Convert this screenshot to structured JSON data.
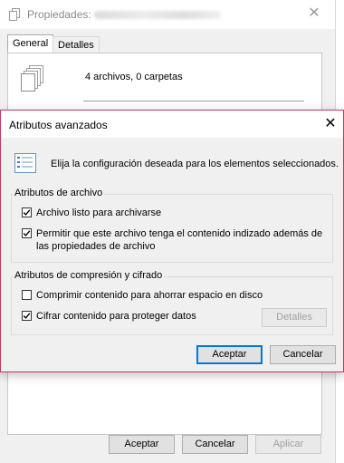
{
  "back_window": {
    "title": "Propiedades:",
    "tabs": [
      "General",
      "Detalles"
    ],
    "summary": "4 archivos, 0 carpetas",
    "buttons": {
      "accept": "Aceptar",
      "cancel": "Cancelar",
      "apply": "Aplicar"
    }
  },
  "dialog": {
    "title": "Atributos avanzados",
    "instruction": "Elija la configuración deseada para los elementos seleccionados.",
    "file_group": {
      "title": "Atributos de archivo",
      "archive": {
        "label": "Archivo listo para archivarse",
        "checked": true
      },
      "index": {
        "label_line1": "Permitir que este archivo tenga el contenido indizado además de",
        "label_line2": "las propiedades de archivo",
        "checked": true
      }
    },
    "compress_group": {
      "title": "Atributos de compresión y cifrado",
      "compress": {
        "label": "Comprimir contenido para ahorrar espacio en disco",
        "checked": false
      },
      "encrypt": {
        "label": "Cifrar contenido para proteger datos",
        "checked": true
      },
      "details_button": "Detalles"
    },
    "buttons": {
      "accept": "Aceptar",
      "cancel": "Cancelar"
    }
  },
  "colors": {
    "accent": "#0078d7",
    "dialog_border": "#c0395f",
    "window_bg": "#f0f0f0"
  }
}
